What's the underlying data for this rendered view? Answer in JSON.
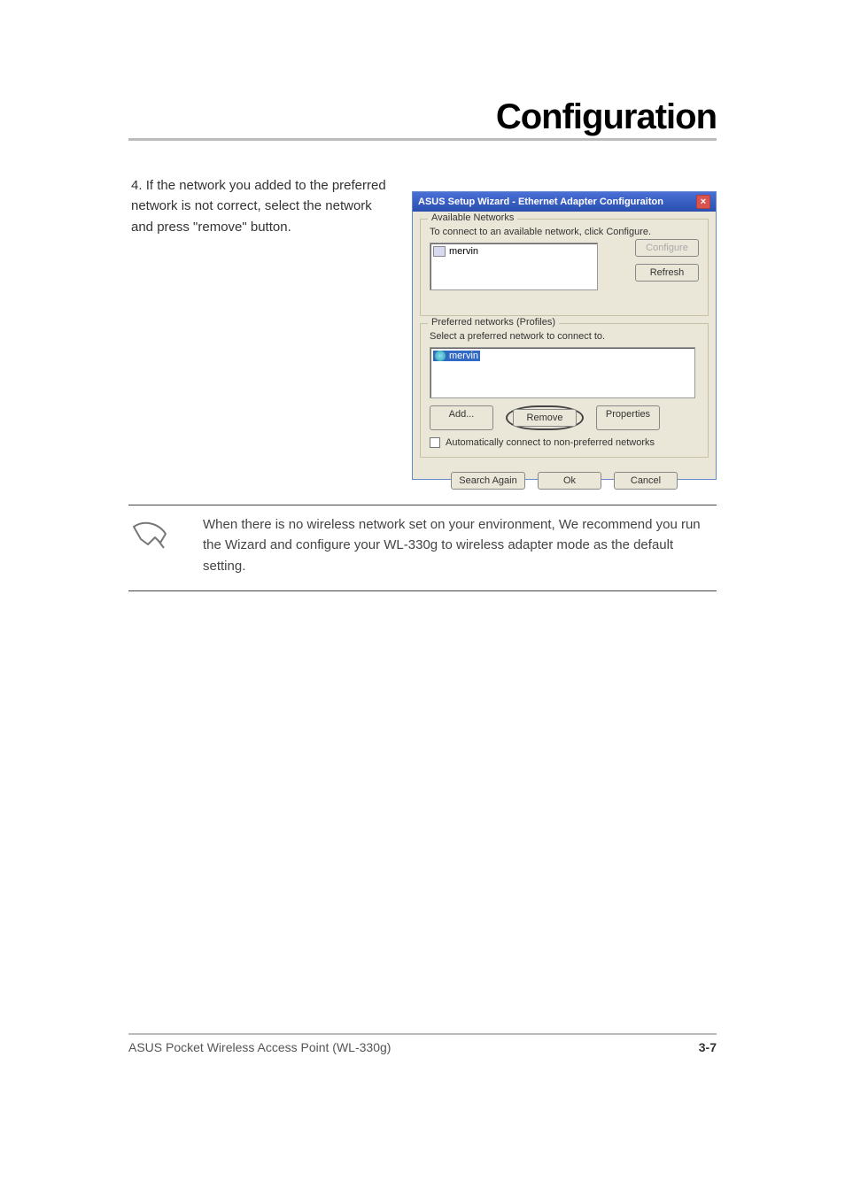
{
  "header": {
    "title": "Configuration"
  },
  "caption": {
    "step": "4.",
    "text": "If the network you added to the preferred network is not correct, select the network and press \"remove\" button."
  },
  "dialog": {
    "title": "ASUS Setup Wizard - Ethernet Adapter Configuraiton",
    "available": {
      "legend": "Available Networks",
      "text": "To connect to an available network, click Configure.",
      "item": "mervin",
      "configure": "Configure",
      "refresh": "Refresh"
    },
    "preferred": {
      "legend": "Preferred networks (Profiles)",
      "text": "Select a preferred network to connect to.",
      "item": "mervin",
      "add": "Add...",
      "remove": "Remove",
      "properties": "Properties",
      "auto": "Automatically connect to non-preferred networks"
    },
    "bottom": {
      "search": "Search Again",
      "ok": "Ok",
      "cancel": "Cancel"
    }
  },
  "note": {
    "text": "When there is no wireless network set on your environment, We recommend you run the Wizard and configure your WL-330g to wireless adapter mode as the default setting."
  },
  "footer": {
    "text": "ASUS Pocket Wireless Access Point (WL-330g)",
    "page": "3-7"
  }
}
